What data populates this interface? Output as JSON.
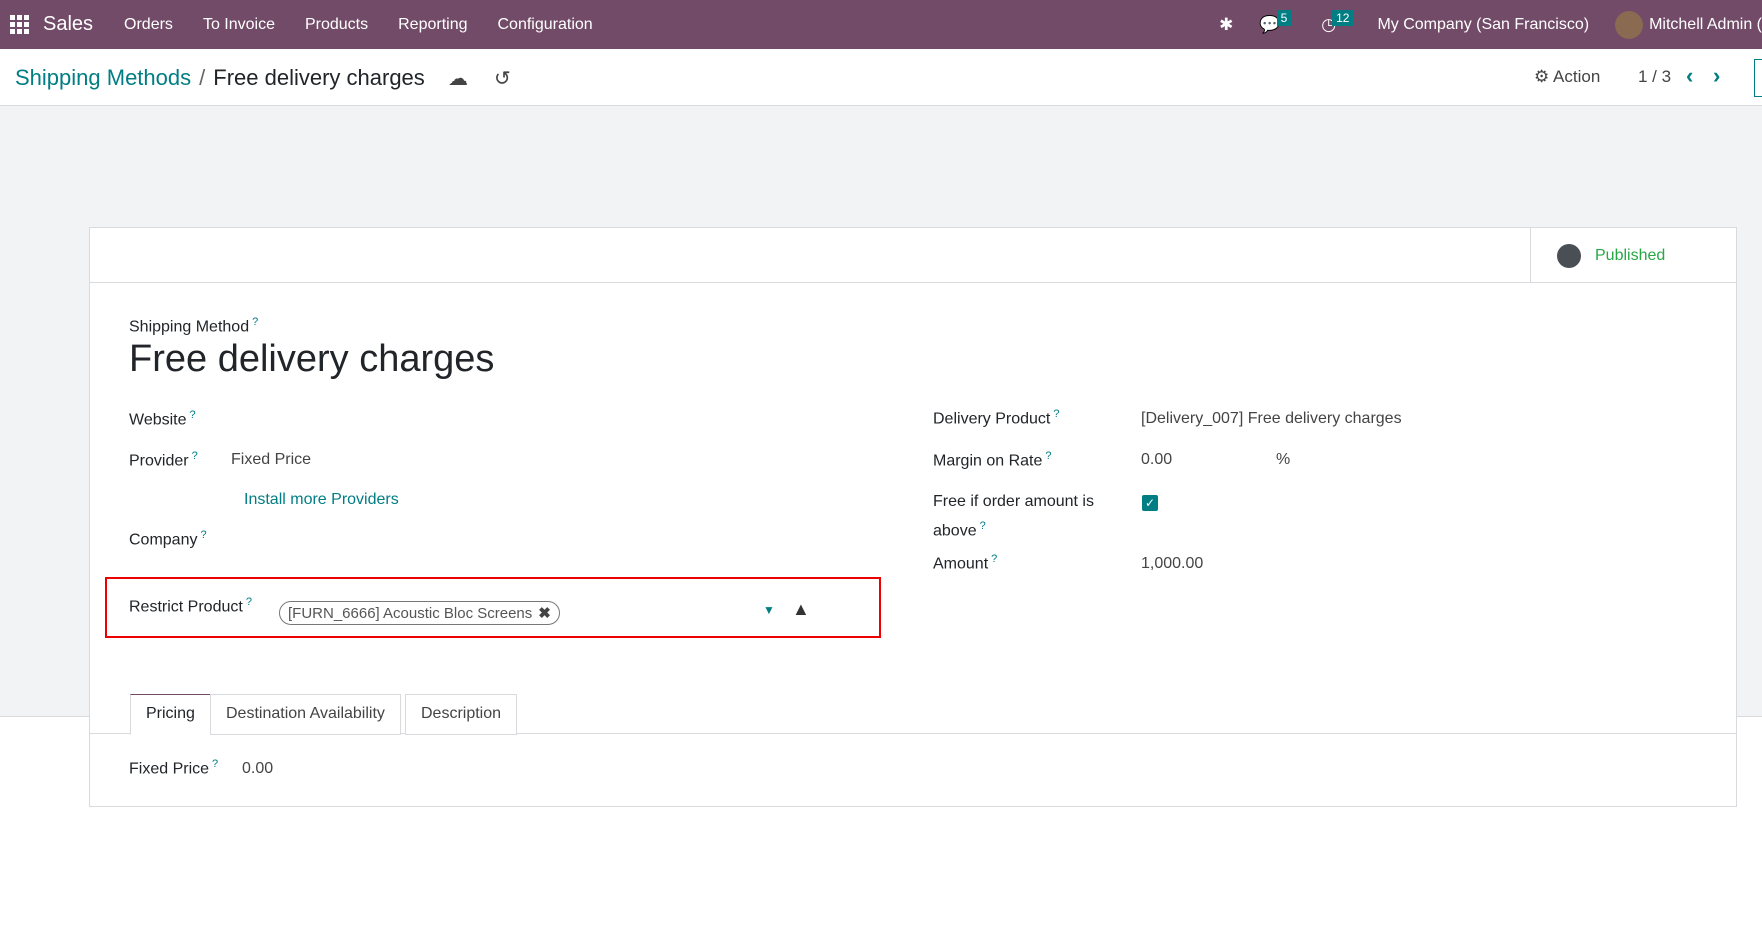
{
  "navbar": {
    "app": "Sales",
    "menus": [
      "Orders",
      "To Invoice",
      "Products",
      "Reporting",
      "Configuration"
    ],
    "messages_count": "5",
    "activities_count": "12",
    "company": "My Company (San Francisco)",
    "user": "Mitchell Admin ("
  },
  "control_panel": {
    "breadcrumb_parent": "Shipping Methods",
    "breadcrumb_sep": "/",
    "breadcrumb_current": "Free delivery charges",
    "action_label": "Action",
    "pager": "1 / 3"
  },
  "status": {
    "published": "Published"
  },
  "form": {
    "shipping_method_label": "Shipping Method",
    "name": "Free delivery charges",
    "website_label": "Website",
    "provider_label": "Provider",
    "provider_value": "Fixed Price",
    "install_link": "Install more Providers",
    "company_label": "Company",
    "restrict_label": "Restrict Product",
    "restrict_tag": "[FURN_6666] Acoustic Bloc Screens",
    "delivery_product_label": "Delivery Product",
    "delivery_product_value": "[Delivery_007] Free delivery charges",
    "margin_label": "Margin on Rate",
    "margin_value": "0.00",
    "margin_unit": "%",
    "free_label_1": "Free if order amount is",
    "free_label_2": "above",
    "free_checked": true,
    "amount_label": "Amount",
    "amount_value": "1,000.00",
    "help": "?"
  },
  "tabs": [
    "Pricing",
    "Destination Availability",
    "Description"
  ],
  "pricing": {
    "fixed_price_label": "Fixed Price",
    "fixed_price_value": "0.00"
  }
}
